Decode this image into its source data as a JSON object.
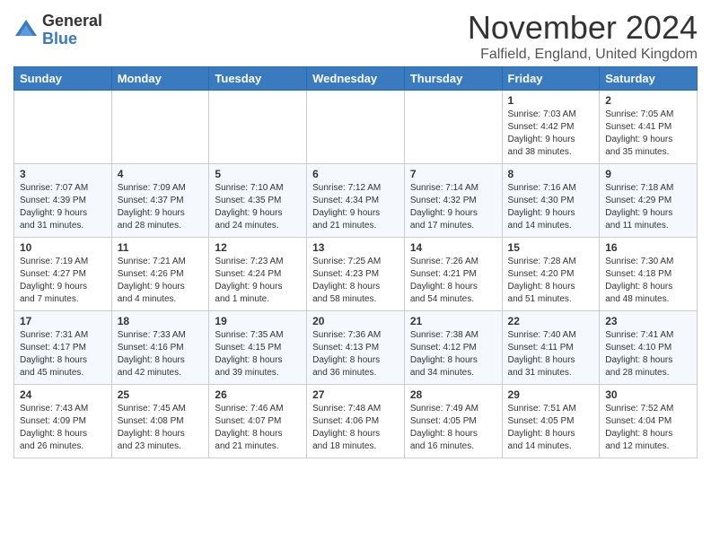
{
  "logo": {
    "general": "General",
    "blue": "Blue"
  },
  "title": "November 2024",
  "location": "Falfield, England, United Kingdom",
  "headers": [
    "Sunday",
    "Monday",
    "Tuesday",
    "Wednesday",
    "Thursday",
    "Friday",
    "Saturday"
  ],
  "weeks": [
    [
      {
        "day": "",
        "info": ""
      },
      {
        "day": "",
        "info": ""
      },
      {
        "day": "",
        "info": ""
      },
      {
        "day": "",
        "info": ""
      },
      {
        "day": "",
        "info": ""
      },
      {
        "day": "1",
        "info": "Sunrise: 7:03 AM\nSunset: 4:42 PM\nDaylight: 9 hours\nand 38 minutes."
      },
      {
        "day": "2",
        "info": "Sunrise: 7:05 AM\nSunset: 4:41 PM\nDaylight: 9 hours\nand 35 minutes."
      }
    ],
    [
      {
        "day": "3",
        "info": "Sunrise: 7:07 AM\nSunset: 4:39 PM\nDaylight: 9 hours\nand 31 minutes."
      },
      {
        "day": "4",
        "info": "Sunrise: 7:09 AM\nSunset: 4:37 PM\nDaylight: 9 hours\nand 28 minutes."
      },
      {
        "day": "5",
        "info": "Sunrise: 7:10 AM\nSunset: 4:35 PM\nDaylight: 9 hours\nand 24 minutes."
      },
      {
        "day": "6",
        "info": "Sunrise: 7:12 AM\nSunset: 4:34 PM\nDaylight: 9 hours\nand 21 minutes."
      },
      {
        "day": "7",
        "info": "Sunrise: 7:14 AM\nSunset: 4:32 PM\nDaylight: 9 hours\nand 17 minutes."
      },
      {
        "day": "8",
        "info": "Sunrise: 7:16 AM\nSunset: 4:30 PM\nDaylight: 9 hours\nand 14 minutes."
      },
      {
        "day": "9",
        "info": "Sunrise: 7:18 AM\nSunset: 4:29 PM\nDaylight: 9 hours\nand 11 minutes."
      }
    ],
    [
      {
        "day": "10",
        "info": "Sunrise: 7:19 AM\nSunset: 4:27 PM\nDaylight: 9 hours\nand 7 minutes."
      },
      {
        "day": "11",
        "info": "Sunrise: 7:21 AM\nSunset: 4:26 PM\nDaylight: 9 hours\nand 4 minutes."
      },
      {
        "day": "12",
        "info": "Sunrise: 7:23 AM\nSunset: 4:24 PM\nDaylight: 9 hours\nand 1 minute."
      },
      {
        "day": "13",
        "info": "Sunrise: 7:25 AM\nSunset: 4:23 PM\nDaylight: 8 hours\nand 58 minutes."
      },
      {
        "day": "14",
        "info": "Sunrise: 7:26 AM\nSunset: 4:21 PM\nDaylight: 8 hours\nand 54 minutes."
      },
      {
        "day": "15",
        "info": "Sunrise: 7:28 AM\nSunset: 4:20 PM\nDaylight: 8 hours\nand 51 minutes."
      },
      {
        "day": "16",
        "info": "Sunrise: 7:30 AM\nSunset: 4:18 PM\nDaylight: 8 hours\nand 48 minutes."
      }
    ],
    [
      {
        "day": "17",
        "info": "Sunrise: 7:31 AM\nSunset: 4:17 PM\nDaylight: 8 hours\nand 45 minutes."
      },
      {
        "day": "18",
        "info": "Sunrise: 7:33 AM\nSunset: 4:16 PM\nDaylight: 8 hours\nand 42 minutes."
      },
      {
        "day": "19",
        "info": "Sunrise: 7:35 AM\nSunset: 4:15 PM\nDaylight: 8 hours\nand 39 minutes."
      },
      {
        "day": "20",
        "info": "Sunrise: 7:36 AM\nSunset: 4:13 PM\nDaylight: 8 hours\nand 36 minutes."
      },
      {
        "day": "21",
        "info": "Sunrise: 7:38 AM\nSunset: 4:12 PM\nDaylight: 8 hours\nand 34 minutes."
      },
      {
        "day": "22",
        "info": "Sunrise: 7:40 AM\nSunset: 4:11 PM\nDaylight: 8 hours\nand 31 minutes."
      },
      {
        "day": "23",
        "info": "Sunrise: 7:41 AM\nSunset: 4:10 PM\nDaylight: 8 hours\nand 28 minutes."
      }
    ],
    [
      {
        "day": "24",
        "info": "Sunrise: 7:43 AM\nSunset: 4:09 PM\nDaylight: 8 hours\nand 26 minutes."
      },
      {
        "day": "25",
        "info": "Sunrise: 7:45 AM\nSunset: 4:08 PM\nDaylight: 8 hours\nand 23 minutes."
      },
      {
        "day": "26",
        "info": "Sunrise: 7:46 AM\nSunset: 4:07 PM\nDaylight: 8 hours\nand 21 minutes."
      },
      {
        "day": "27",
        "info": "Sunrise: 7:48 AM\nSunset: 4:06 PM\nDaylight: 8 hours\nand 18 minutes."
      },
      {
        "day": "28",
        "info": "Sunrise: 7:49 AM\nSunset: 4:05 PM\nDaylight: 8 hours\nand 16 minutes."
      },
      {
        "day": "29",
        "info": "Sunrise: 7:51 AM\nSunset: 4:05 PM\nDaylight: 8 hours\nand 14 minutes."
      },
      {
        "day": "30",
        "info": "Sunrise: 7:52 AM\nSunset: 4:04 PM\nDaylight: 8 hours\nand 12 minutes."
      }
    ]
  ]
}
